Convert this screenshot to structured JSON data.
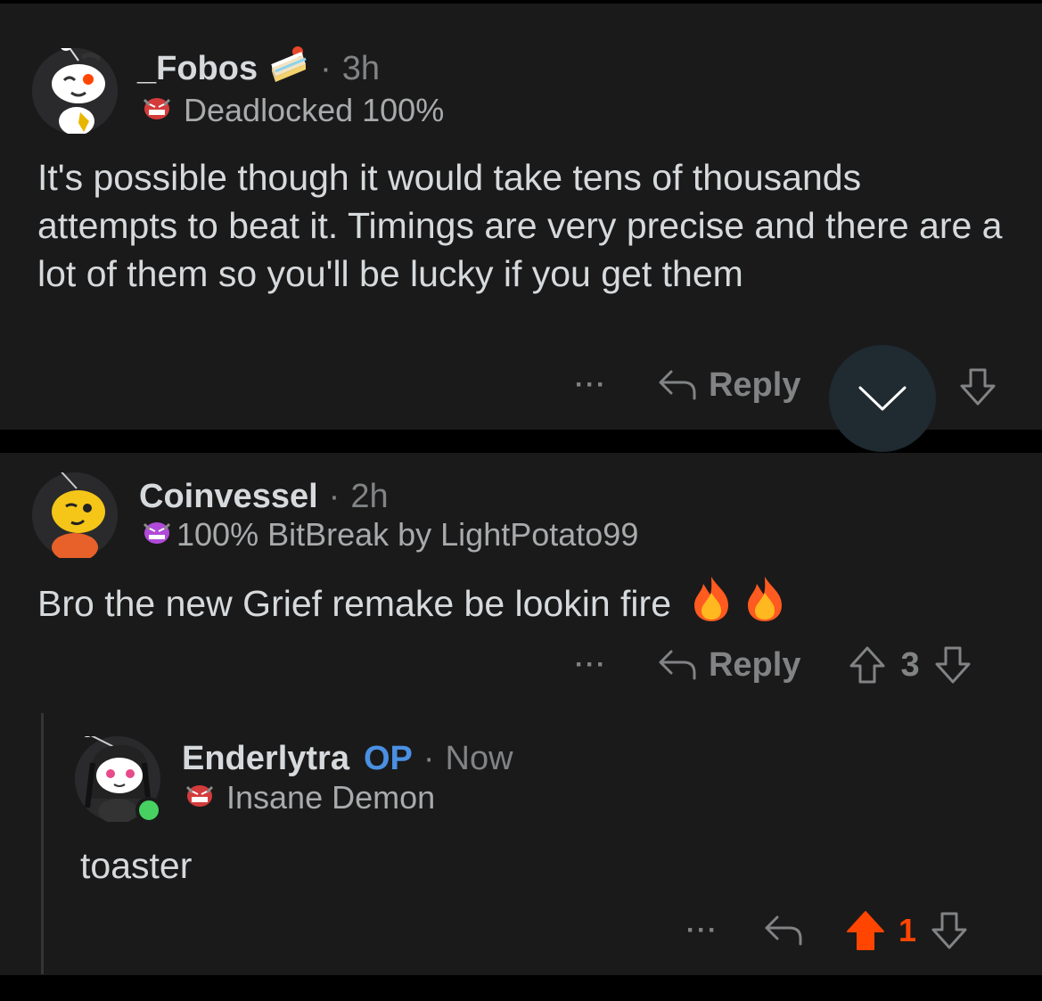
{
  "comments": [
    {
      "username": "_Fobos",
      "separator": "·",
      "time": "3h",
      "flair": "Deadlocked 100%",
      "body": "It's possible though it would take tens of thousands attempts to beat it. Timings are very precise and there are a lot of them so you'll be lucky if you get them",
      "reply_label": "Reply"
    },
    {
      "username": "Coinvessel",
      "separator": "·",
      "time": "2h",
      "flair": "100% BitBreak by LightPotato99",
      "body": "Bro the new Grief remake be lookin fire",
      "reply_label": "Reply",
      "score": "3"
    },
    {
      "username": "Enderlytra",
      "op_badge": "OP",
      "separator": "·",
      "time": "Now",
      "flair": "Insane Demon",
      "body": "toaster",
      "score": "1"
    }
  ],
  "more_label": "···",
  "colors": {
    "background": "#000000",
    "card": "#1a1a1b",
    "text": "#d7dadc",
    "meta": "#818384",
    "op": "#4a90e2",
    "upvote": "#ff4500",
    "online": "#46d160"
  }
}
